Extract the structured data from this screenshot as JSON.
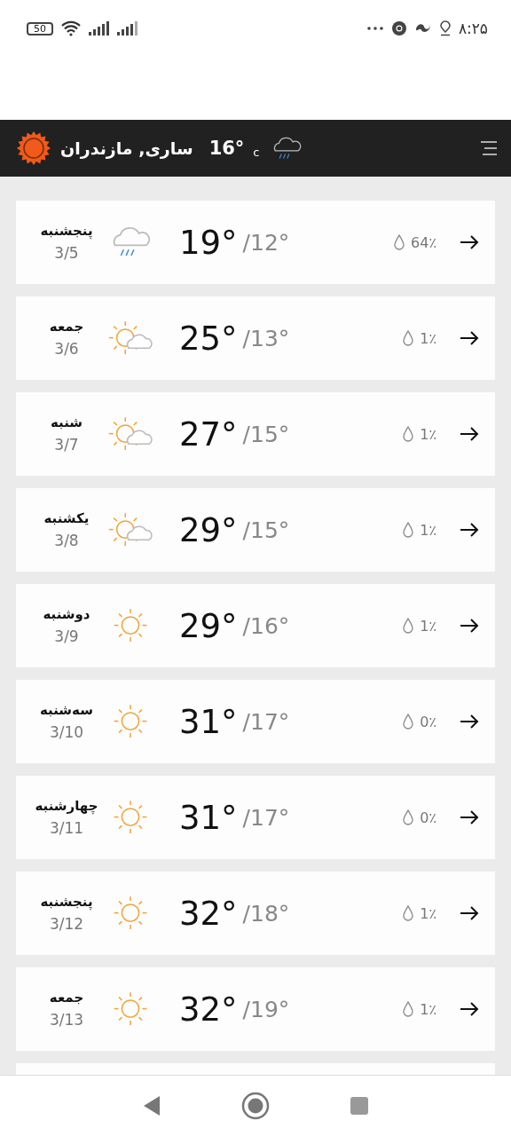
{
  "status_bar": {
    "battery": "50",
    "time": "۸:۲۵"
  },
  "header": {
    "location": "ساری, مازندران",
    "temperature": "16°",
    "unit": "c",
    "kind": "rain"
  },
  "forecast": [
    {
      "day": "پنجشنبه",
      "date": "3/5",
      "kind": "rain",
      "high": "19°",
      "low": "/12°",
      "precipitation": "64٪"
    },
    {
      "day": "جمعه",
      "date": "3/6",
      "kind": "partly-cloudy",
      "high": "25°",
      "low": "/13°",
      "precipitation": "1٪"
    },
    {
      "day": "شنبه",
      "date": "3/7",
      "kind": "partly-cloudy",
      "high": "27°",
      "low": "/15°",
      "precipitation": "1٪"
    },
    {
      "day": "یکشنبه",
      "date": "3/8",
      "kind": "partly-cloudy",
      "high": "29°",
      "low": "/15°",
      "precipitation": "1٪"
    },
    {
      "day": "دوشنبه",
      "date": "3/9",
      "kind": "sunny",
      "high": "29°",
      "low": "/16°",
      "precipitation": "1٪"
    },
    {
      "day": "سه‌شنبه",
      "date": "3/10",
      "kind": "sunny",
      "high": "31°",
      "low": "/17°",
      "precipitation": "0٪"
    },
    {
      "day": "چهارشنبه",
      "date": "3/11",
      "kind": "sunny",
      "high": "31°",
      "low": "/17°",
      "precipitation": "0٪"
    },
    {
      "day": "پنجشنبه",
      "date": "3/12",
      "kind": "sunny",
      "high": "32°",
      "low": "/18°",
      "precipitation": "1٪"
    },
    {
      "day": "جمعه",
      "date": "3/13",
      "kind": "sunny",
      "high": "32°",
      "low": "/19°",
      "precipitation": "1٪"
    }
  ]
}
